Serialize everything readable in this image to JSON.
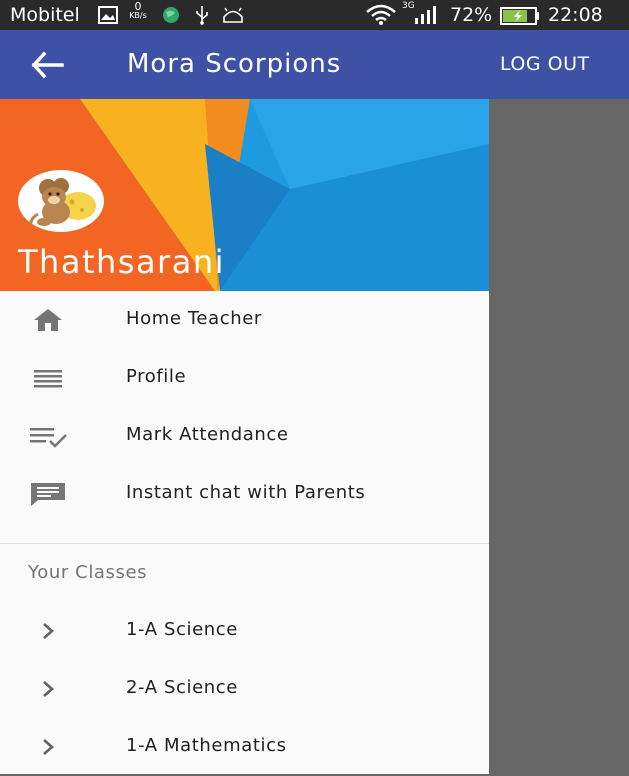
{
  "status_bar": {
    "carrier": "Mobitel",
    "net_speed_value": "0",
    "net_speed_unit": "KB/s",
    "network_type": "3G",
    "battery_percent": "72%",
    "time": "22:08",
    "icons": [
      "image-icon",
      "globe-icon",
      "usb-icon",
      "android-icon",
      "wifi-icon",
      "signal-icon",
      "battery-icon"
    ]
  },
  "app_bar": {
    "title": "Mora Scorpions",
    "logout_label": "LOG OUT",
    "color": "#3f51a5"
  },
  "drawer": {
    "user_name": "Thathsarani",
    "menu": [
      {
        "label": "Home Teacher",
        "icon": "home-icon"
      },
      {
        "label": "Profile",
        "icon": "lines-icon"
      },
      {
        "label": "Mark Attendance",
        "icon": "checklist-icon"
      },
      {
        "label": "Instant chat with Parents",
        "icon": "chat-icon"
      }
    ],
    "section_title": "Your Classes",
    "classes": [
      {
        "label": "1-A Science",
        "icon": "chevron-right-icon"
      },
      {
        "label": "2-A Science",
        "icon": "chevron-right-icon"
      },
      {
        "label": "1-A Mathematics",
        "icon": "chevron-right-icon"
      }
    ]
  },
  "colors": {
    "scrim": "#666666",
    "header_orange": "#f26522",
    "header_yellow": "#f9b21f",
    "header_blue": "#1e9be0"
  }
}
